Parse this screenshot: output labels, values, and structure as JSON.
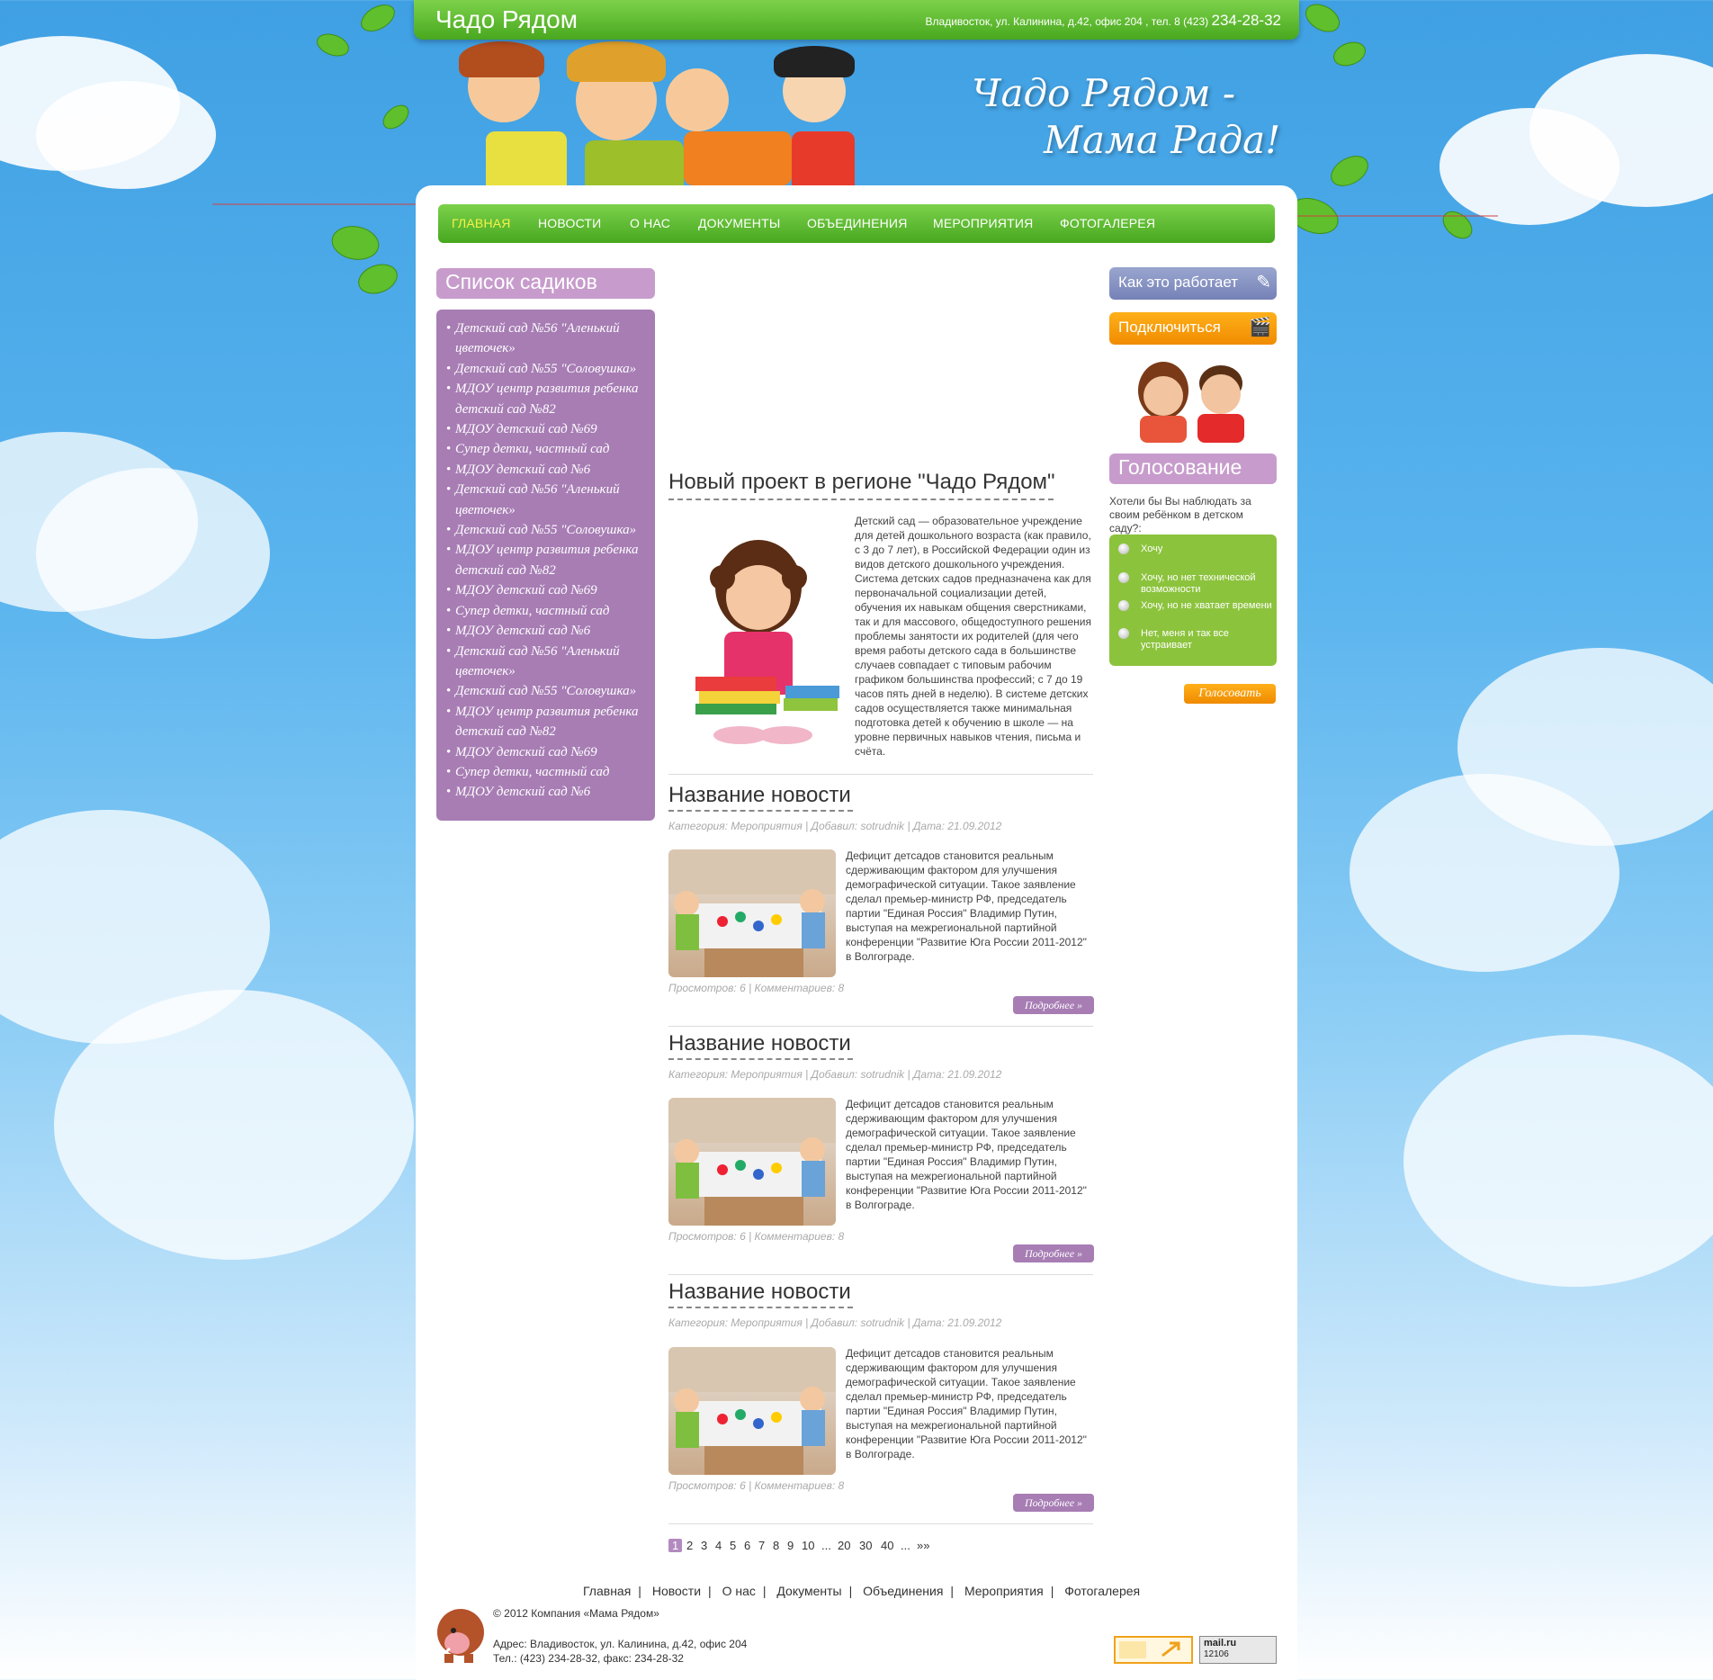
{
  "header": {
    "site_title": "Чадо Рядом",
    "contact_prefix": "Владивосток, ул. Калинина, д.42, офис 204 , тел. 8 (423)",
    "contact_phone": "234-28-32",
    "slogan_line1": "Чадо Рядом -",
    "slogan_line2": "Мама Рада!"
  },
  "nav": {
    "items": [
      "Главная",
      "Новости",
      "О нас",
      "Документы",
      "Объединения",
      "Мероприятия",
      "Фотогалерея"
    ],
    "active": "Главная"
  },
  "sidebar": {
    "title": "Список садиков",
    "items": [
      "Детский сад №56 \"Аленький цветочек»",
      "Детский сад №55 \"Соловушка»",
      "МДОУ центр развития ребенка детский сад №82",
      "МДОУ детский сад №69",
      "Супер детки, частный сад",
      "МДОУ детский сад №6",
      "Детский сад №56 \"Аленький цветочек»",
      "Детский сад №55 \"Соловушка»",
      "МДОУ центр развития ребенка детский сад №82",
      "МДОУ детский сад №69",
      "Супер детки, частный сад",
      "МДОУ детский сад №6",
      "Детский сад №56 \"Аленький цветочек»",
      "Детский сад №55 \"Соловушка»",
      "МДОУ центр развития ребенка детский сад №82",
      "МДОУ детский сад №69",
      "Супер детки, частный сад",
      "МДОУ детский сад №6"
    ]
  },
  "main_article": {
    "title": "Новый проект в регионе \"Чадо Рядом\"",
    "text": "Детский сад — образовательное учреждение для детей дошкольного возраста (как правило, с 3 до 7 лет), в Российской Федерации один из видов детского дошкольного учреждения. Система детских садов предназначена как для первоначальной социализации детей, обучения их навыкам общения сверстниками, так и для массового, общедоступного решения проблемы занятости их родителей (для чего время работы детского сада в большинстве случаев совпадает с типовым рабочим графиком большинства профессий; с 7 до 19 часов пять дней в неделю). В системе детских садов осуществляется также минимальная подготовка детей к обучению в школе — на уровне первичных навыков чтения, письма и счёта."
  },
  "news": [
    {
      "title": "Название новости",
      "meta": "Категория: Мероприятия | Добавил: sotrudnik | Дата: 21.09.2012",
      "text": "Дефицит детсадов становится реальным сдерживающим фактором для улучшения демографической ситуации. Такое заявление сделал премьер-министр РФ, председатель партии \"Единая Россия\" Владимир Путин, выступая на межрегиональной партийной конференции \"Развитие Юга России 2011-2012\" в Волгограде.",
      "stats": "Просмотров: 6 | Комментариев: 8",
      "more": "Подробнее »"
    },
    {
      "title": "Название новости",
      "meta": "Категория: Мероприятия | Добавил: sotrudnik | Дата: 21.09.2012",
      "text": "Дефицит детсадов становится реальным сдерживающим фактором для улучшения демографической ситуации. Такое заявление сделал премьер-министр РФ, председатель партии \"Единая Россия\" Владимир Путин, выступая на межрегиональной партийной конференции \"Развитие Юга России 2011-2012\" в Волгограде.",
      "stats": "Просмотров: 6 | Комментариев: 8",
      "more": "Подробнее »"
    },
    {
      "title": "Название новости",
      "meta": "Категория: Мероприятия | Добавил: sotrudnik | Дата: 21.09.2012",
      "text": "Дефицит детсадов становится реальным сдерживающим фактором для улучшения демографической ситуации. Такое заявление сделал премьер-министр РФ, председатель партии \"Единая Россия\" Владимир Путин, выступая на межрегиональной партийной конференции \"Развитие Юга России 2011-2012\" в Волгограде.",
      "stats": "Просмотров: 6 | Комментариев: 8",
      "more": "Подробнее »"
    }
  ],
  "pager": {
    "current": "1",
    "pages": [
      "2",
      "3",
      "4",
      "5",
      "6",
      "7",
      "8",
      "9",
      "10",
      "...",
      "20",
      "30",
      "40",
      "...",
      "»»"
    ]
  },
  "right": {
    "how_it_works": "Как это работает",
    "connect": "Подключиться",
    "vote_title": "Голосование",
    "vote_question": "Хотели бы Вы наблюдать за своим ребёнком в детском саду?:",
    "options": [
      "Хочу",
      "Хочу, но нет технической возможности",
      "Хочу, но не хватает времени",
      "Нет, меня и так все устраивает"
    ],
    "vote_button": "Голосовать"
  },
  "footer": {
    "links": [
      "Главная",
      "Новости",
      "О нас",
      "Документы",
      "Объединения",
      "Мероприятия",
      "Фотогалерея"
    ],
    "copyright": "© 2012 Компания «Мама Рядом»",
    "address": "Адрес: Владивосток, ул. Калинина, д.42, офис 204",
    "phones": "Тел.: (423) 234-28-32, факс: 234-28-32",
    "counter_mailru_label": "mail.ru",
    "counter_mailru_value": "12106"
  },
  "colors": {
    "green": "#5ab62c",
    "purple": "#a77db4",
    "lilac": "#c79ccc",
    "orange": "#f39800",
    "sky": "#4aa8e8"
  }
}
